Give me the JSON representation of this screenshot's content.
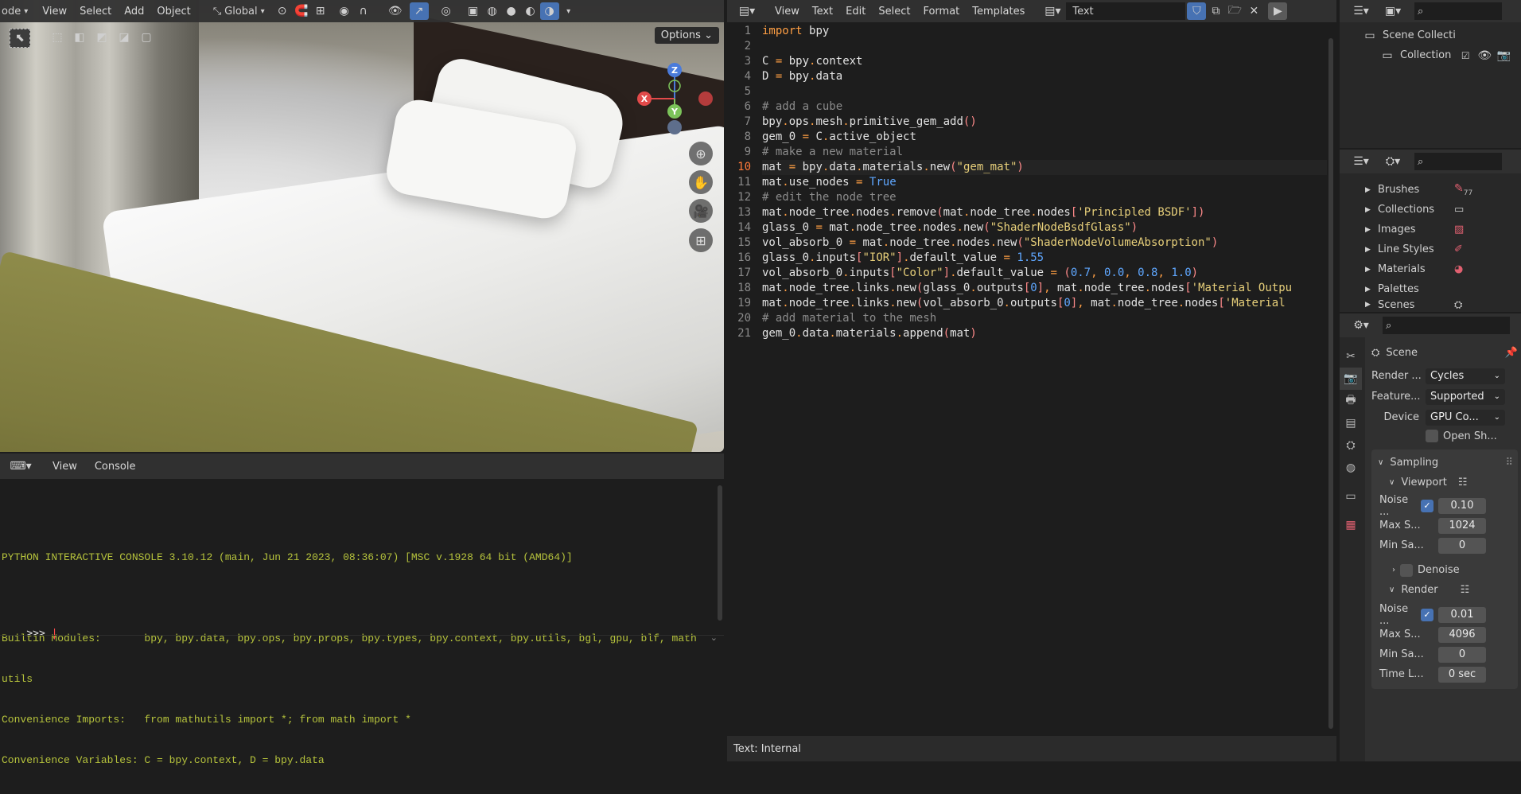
{
  "viewport_header": {
    "mode_label": "ode",
    "menus": [
      "View",
      "Select",
      "Add",
      "Object"
    ],
    "orientation": "Global",
    "options_label": "Options"
  },
  "gizmo": {
    "z": "Z",
    "x": "X",
    "y": "Y"
  },
  "console": {
    "menus": [
      "View",
      "Console"
    ],
    "lines": [
      "PYTHON INTERACTIVE CONSOLE 3.10.12 (main, Jun 21 2023, 08:36:07) [MSC v.1928 64 bit (AMD64)]",
      "",
      "Builtin Modules:       bpy, bpy.data, bpy.ops, bpy.props, bpy.types, bpy.context, bpy.utils, bgl, gpu, blf, math",
      "utils",
      "Convenience Imports:   from mathutils import *; from math import *",
      "Convenience Variables: C = bpy.context, D = bpy.data"
    ],
    "prompt": ">>> "
  },
  "editor": {
    "menus": [
      "View",
      "Text",
      "Edit",
      "Select",
      "Format",
      "Templates"
    ],
    "text_name": "Text",
    "footer": "Text: Internal",
    "active_line": 10,
    "lines": [
      "import bpy",
      "",
      "C = bpy.context",
      "D = bpy.data",
      "",
      "# add a cube",
      "bpy.ops.mesh.primitive_gem_add()",
      "gem_0 = C.active_object",
      "# make a new material",
      "mat = bpy.data.materials.new(\"gem_mat\")",
      "mat.use_nodes = True",
      "# edit the node tree",
      "mat.node_tree.nodes.remove(mat.node_tree.nodes['Principled BSDF'])",
      "glass_0 = mat.node_tree.nodes.new(\"ShaderNodeBsdfGlass\")",
      "vol_absorb_0 = mat.node_tree.nodes.new(\"ShaderNodeVolumeAbsorption\")",
      "glass_0.inputs[\"IOR\"].default_value = 1.55",
      "vol_absorb_0.inputs[\"Color\"].default_value = (0.7, 0.0, 0.8, 1.0)",
      "mat.node_tree.links.new(glass_0.outputs[0], mat.node_tree.nodes['Material Outpu",
      "mat.node_tree.links.new(vol_absorb_0.outputs[0], mat.node_tree.nodes['Material ",
      "# add material to the mesh",
      "gem_0.data.materials.append(mat)"
    ]
  },
  "outliner": {
    "scene_collection": "Scene Collecti",
    "collection": "Collection"
  },
  "databrowser": {
    "items": [
      "Brushes",
      "Collections",
      "Images",
      "Line Styles",
      "Materials",
      "Palettes",
      "Scenes"
    ],
    "brush_count": "77"
  },
  "properties": {
    "scene_label": "Scene",
    "render_engine_label": "Render ...",
    "render_engine_value": "Cycles",
    "feature_label": "Feature...",
    "feature_value": "Supported",
    "device_label": "Device",
    "device_value": "GPU Co...",
    "open_shading": "Open Sh...",
    "sampling": "Sampling",
    "viewport": "Viewport",
    "vp_noise_label": "Noise ...",
    "vp_noise_value": "0.10",
    "vp_max_label": "Max S...",
    "vp_max_value": "1024",
    "vp_min_label": "Min Sa...",
    "vp_min_value": "0",
    "denoise": "Denoise",
    "render": "Render",
    "r_noise_label": "Noise ...",
    "r_noise_value": "0.01",
    "r_max_label": "Max S...",
    "r_max_value": "4096",
    "r_min_label": "Min Sa...",
    "r_min_value": "0",
    "time_label": "Time L...",
    "time_value": "0 sec"
  }
}
